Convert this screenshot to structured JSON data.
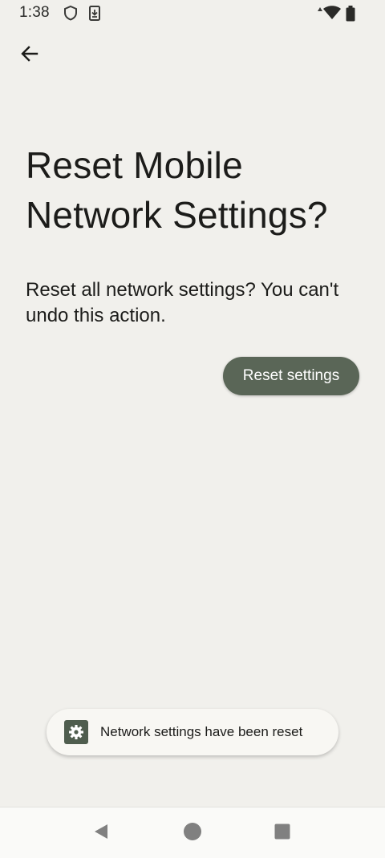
{
  "status_bar": {
    "time": "1:38",
    "icons": [
      "shield-icon",
      "download-icon",
      "signal-icon",
      "wifi-icon",
      "battery-icon"
    ]
  },
  "header": {
    "back_icon": "arrow-back-icon"
  },
  "main": {
    "title": "Reset Mobile Network Settings?",
    "description": "Reset all network settings? You can't undo this action.",
    "reset_button_label": "Reset settings"
  },
  "toast": {
    "icon": "gear-icon",
    "message": "Network settings have been reset"
  },
  "nav_bar": {
    "buttons": [
      "nav-back-icon",
      "nav-home-icon",
      "nav-recents-icon"
    ]
  },
  "colors": {
    "background": "#f1f0ec",
    "accent": "#5a6657",
    "toast_background": "#f8f7f3",
    "text": "#1c1c1a"
  }
}
